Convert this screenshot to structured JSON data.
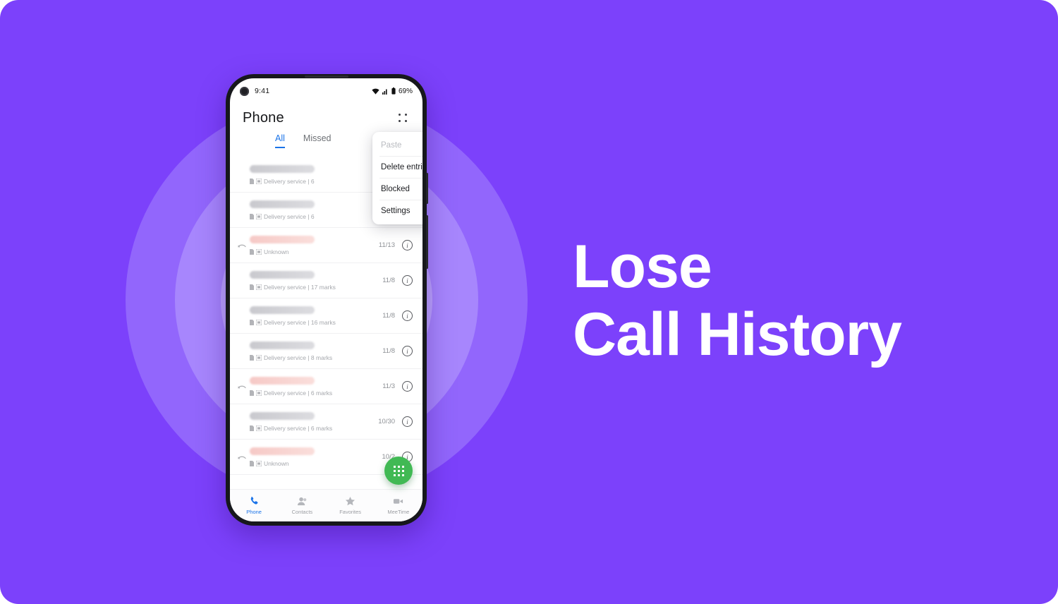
{
  "theme": {
    "background_purple": "#7c41fb",
    "ring_outer": "#9266fc",
    "ring_mid": "#a786fd",
    "ring_inner": "#bda4fe",
    "accent_blue": "#1a73e8",
    "fab_green": "#41b954",
    "headline_color": "#ffffff"
  },
  "headline": {
    "line1": "Lose",
    "line2": "Call History"
  },
  "phone": {
    "status_bar": {
      "time": "9:41",
      "battery_percent": "69%",
      "icons": [
        "wifi-icon",
        "cellular-signal-icon",
        "battery-icon"
      ]
    },
    "app_bar": {
      "title": "Phone",
      "overflow_icon": "overflow-menu-icon"
    },
    "tabs": [
      {
        "label": "All",
        "active": true
      },
      {
        "label": "Missed",
        "active": false
      }
    ],
    "overflow_menu": {
      "items": [
        {
          "label": "Paste",
          "disabled": true
        },
        {
          "label": "Delete entries",
          "disabled": false
        },
        {
          "label": "Blocked",
          "disabled": false
        },
        {
          "label": "Settings",
          "disabled": false
        }
      ]
    },
    "call_list": [
      {
        "missed": false,
        "subtitle": "Delivery service | 6 ",
        "date": "",
        "show_meta": false
      },
      {
        "missed": false,
        "subtitle": "Delivery service | 6 ",
        "date": "",
        "show_meta": false
      },
      {
        "missed": true,
        "subtitle": "Unknown",
        "date": "11/13",
        "show_meta": true
      },
      {
        "missed": false,
        "subtitle": "Delivery service | 17 marks",
        "date": "11/8",
        "show_meta": true
      },
      {
        "missed": false,
        "subtitle": "Delivery service | 16 marks",
        "date": "11/8",
        "show_meta": true
      },
      {
        "missed": false,
        "subtitle": "Delivery service | 8 marks",
        "date": "11/8",
        "show_meta": true
      },
      {
        "missed": true,
        "subtitle": "Delivery service | 6 marks",
        "date": "11/3",
        "show_meta": true
      },
      {
        "missed": false,
        "subtitle": "Delivery service | 6 marks",
        "date": "10/30",
        "show_meta": true
      },
      {
        "missed": true,
        "subtitle": "Unknown",
        "date": "10/2",
        "show_meta": true
      }
    ],
    "fab": {
      "icon": "dialpad-icon"
    },
    "bottom_nav": [
      {
        "label": "Phone",
        "icon": "phone-icon",
        "active": true
      },
      {
        "label": "Contacts",
        "icon": "contacts-icon",
        "active": false
      },
      {
        "label": "Favorites",
        "icon": "star-icon",
        "active": false
      },
      {
        "label": "MeeTime",
        "icon": "video-call-icon",
        "active": false
      }
    ]
  }
}
